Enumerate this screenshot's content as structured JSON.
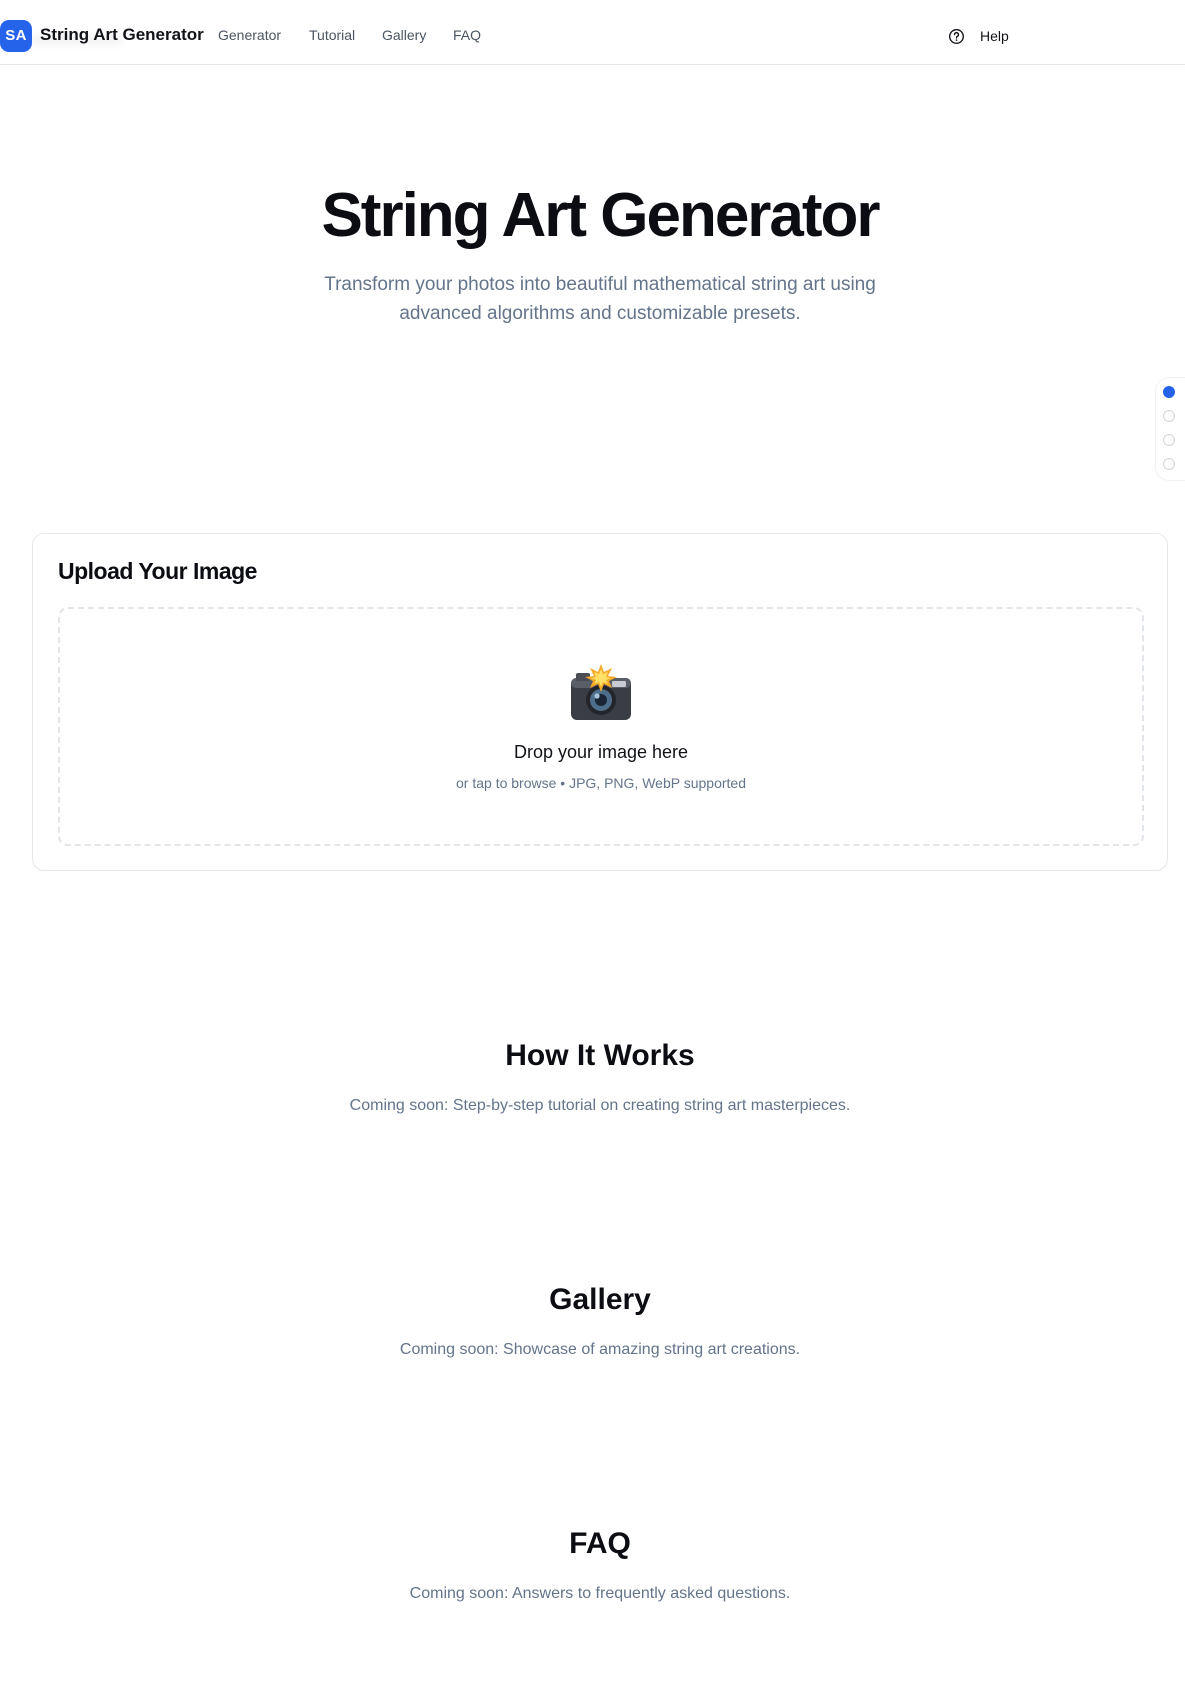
{
  "header": {
    "brand_badge": "SA",
    "brand_name": "String Art Generator",
    "nav": [
      "Generator",
      "Tutorial",
      "Gallery",
      "FAQ"
    ],
    "help_label": "Help"
  },
  "hero": {
    "title": "String Art Generator",
    "subtitle": "Transform your photos into beautiful mathematical string art using advanced algorithms and customizable presets."
  },
  "section_nav": {
    "active_index": 0,
    "count": 4
  },
  "upload": {
    "title": "Upload Your Image",
    "icon": "camera-flash-icon",
    "drop_title": "Drop your image here",
    "drop_hint": "or tap to browse • JPG, PNG, WebP supported"
  },
  "sections": [
    {
      "title": "How It Works",
      "text": "Coming soon: Step-by-step tutorial on creating string art masterpieces."
    },
    {
      "title": "Gallery",
      "text": "Coming soon: Showcase of amazing string art creations."
    },
    {
      "title": "FAQ",
      "text": "Coming soon: Answers to frequently asked questions."
    }
  ],
  "colors": {
    "accent": "#2563eb",
    "muted_text": "#64748b",
    "border": "#e5e7eb"
  }
}
